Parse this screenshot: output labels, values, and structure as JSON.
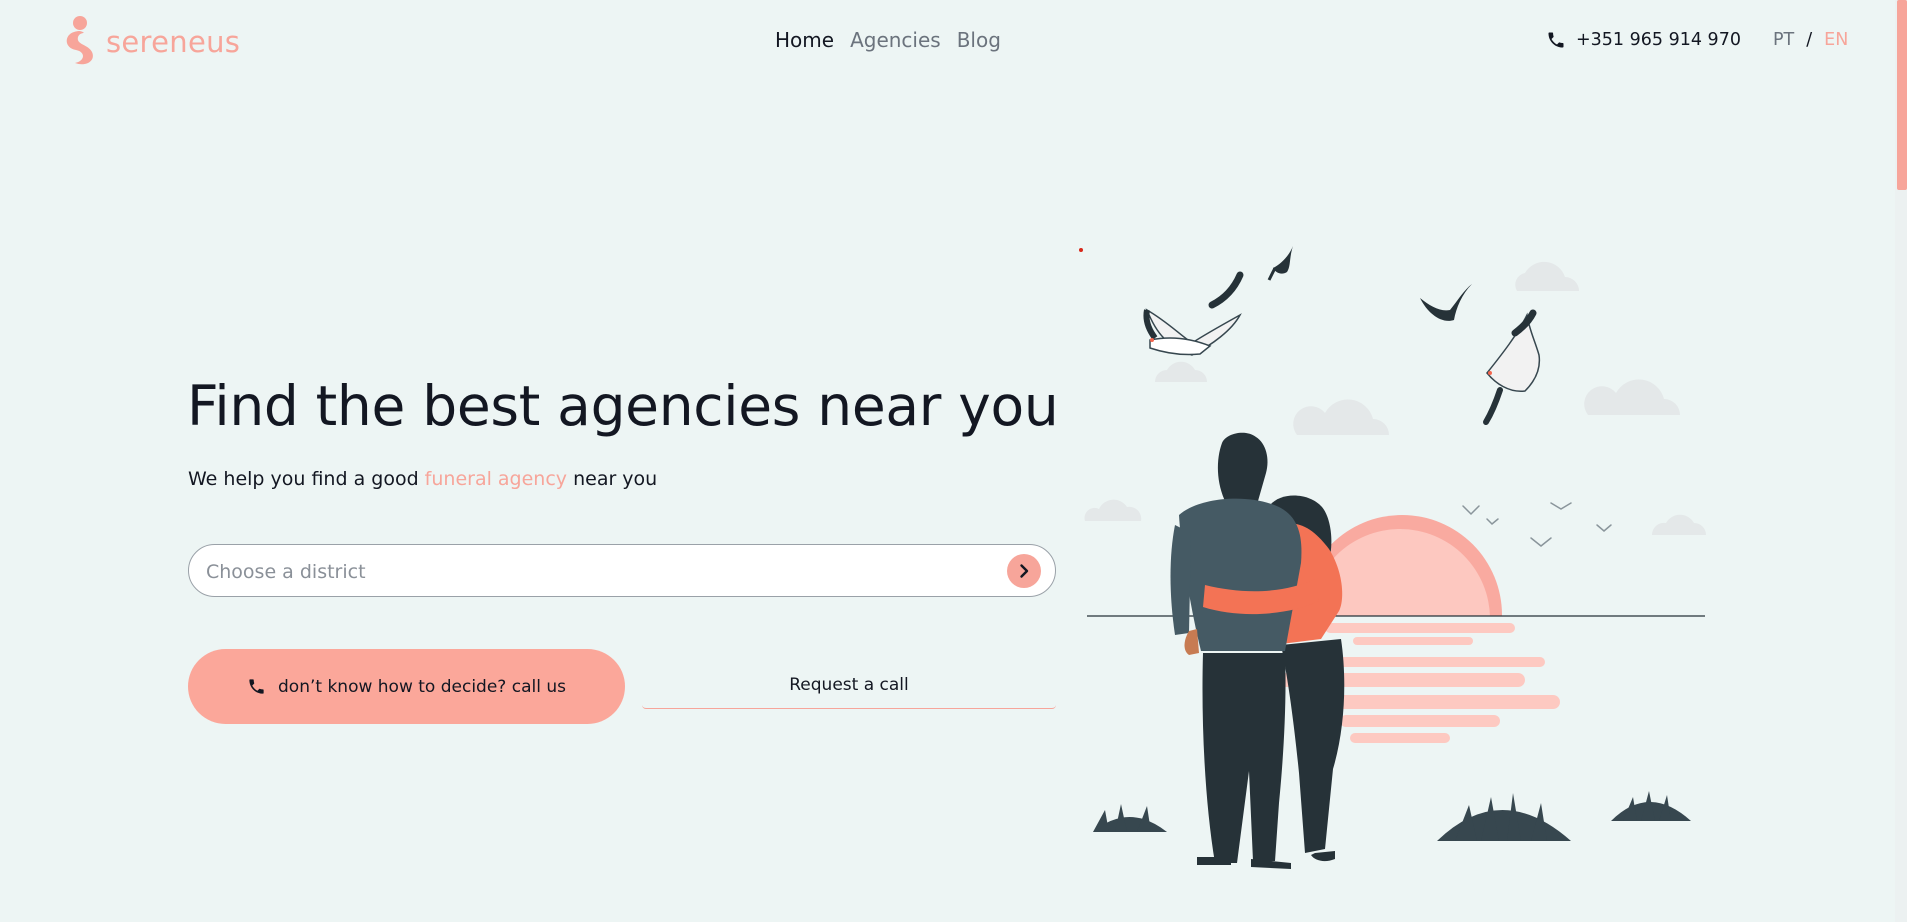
{
  "header": {
    "logo_text": "sereneus",
    "nav": [
      {
        "label": "Home",
        "active": true
      },
      {
        "label": "Agencies",
        "active": false
      },
      {
        "label": "Blog",
        "active": false
      }
    ],
    "phone_icon": "phone-icon",
    "phone": "+351 965 914 970",
    "lang": {
      "pt": "PT",
      "separator": "/",
      "en": "EN",
      "active": "EN"
    }
  },
  "hero": {
    "title": "Find the best agencies near you",
    "subtitle_before": "We help you find a good ",
    "subtitle_highlight": "funeral agency",
    "subtitle_after": " near you",
    "search": {
      "placeholder": "Choose a district",
      "value": "",
      "button_icon": "chevron-right-icon"
    },
    "cta_call": {
      "label": "don’t know how to decide? call us",
      "icon": "phone-icon"
    },
    "cta_request": {
      "label": "Request a call"
    }
  },
  "illustration": {
    "name": "couple-watching-sunset-illustration"
  },
  "colors": {
    "background": "#edf5f4",
    "accent": "#f7a59a",
    "accent_strong": "#fba79a",
    "text": "#131722",
    "muted_text": "#6b737d",
    "dark_figure": "#263238",
    "shirt": "#455a64"
  }
}
